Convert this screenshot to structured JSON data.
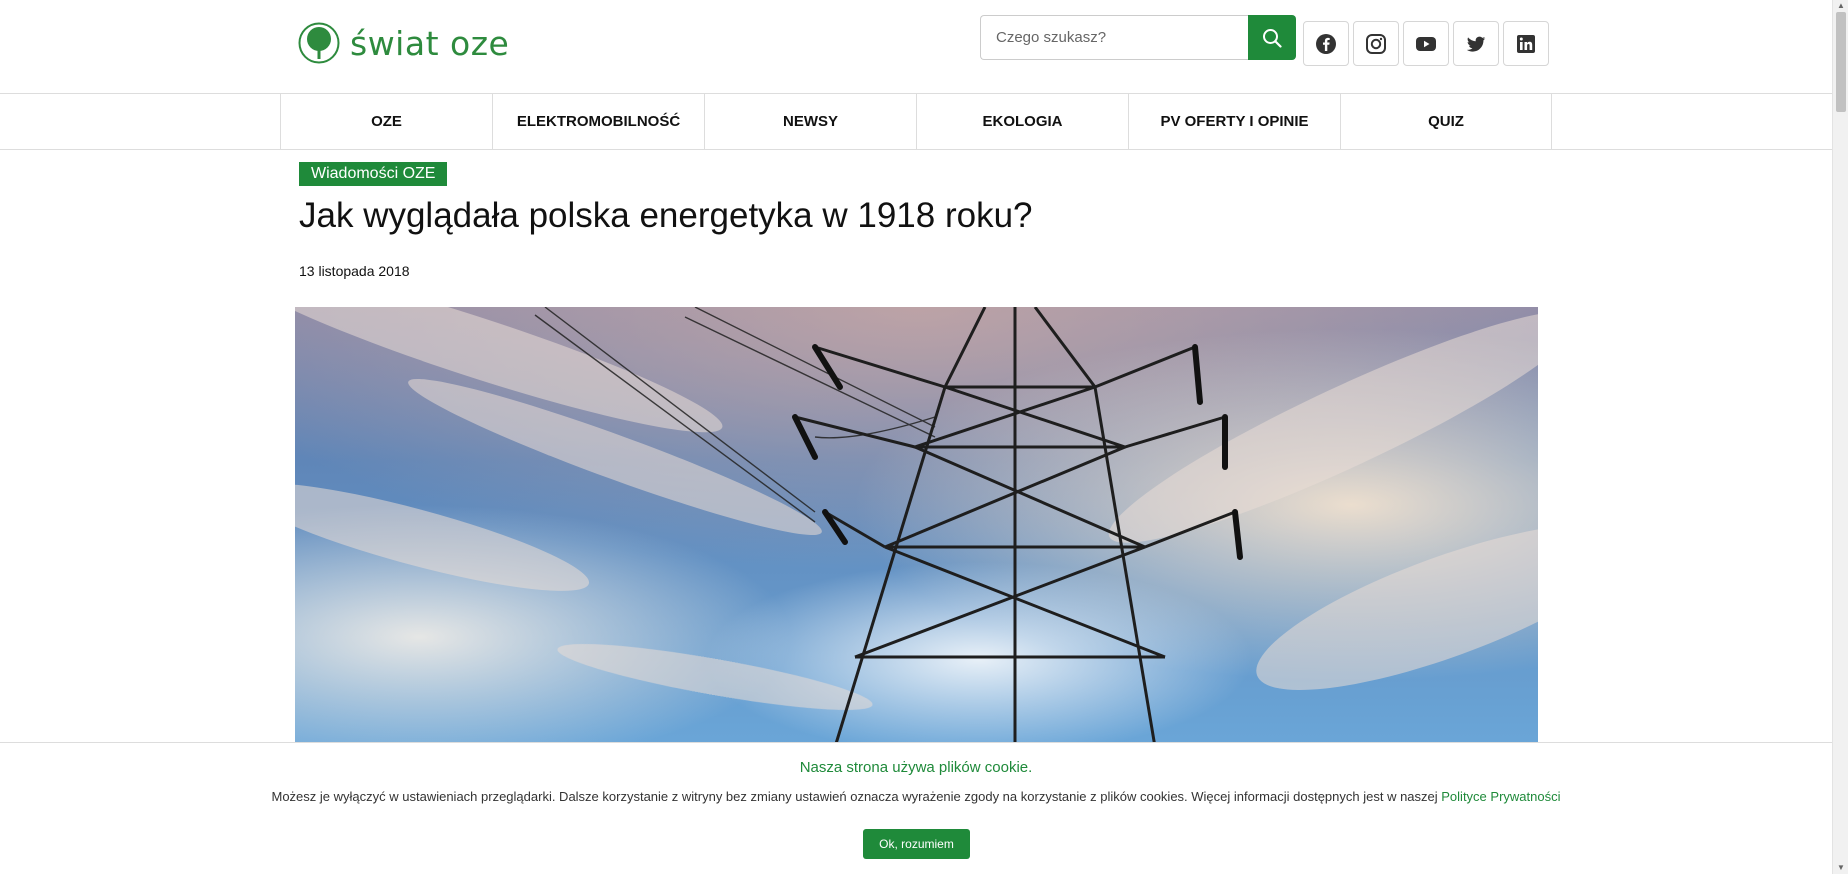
{
  "header": {
    "logo_text": "świat oze",
    "search": {
      "placeholder": "Czego szukasz?"
    },
    "socials": [
      "facebook-icon",
      "instagram-icon",
      "youtube-icon",
      "twitter-icon",
      "linkedin-icon"
    ]
  },
  "nav": {
    "items": [
      {
        "label": "OZE"
      },
      {
        "label": "ELEKTROMOBILNOŚĆ"
      },
      {
        "label": "NEWSY"
      },
      {
        "label": "EKOLOGIA"
      },
      {
        "label": "PV OFERTY I OPINIE"
      },
      {
        "label": "QUIZ"
      }
    ]
  },
  "article": {
    "category": "Wiadomości OZE",
    "title": "Jak wyglądała polska energetyka w 1918 roku?",
    "date": "13 listopada 2018"
  },
  "cookie": {
    "title": "Nasza strona używa plików cookie.",
    "text": "Możesz je wyłączyć w ustawieniach przeglądarki. Dalsze korzystanie z witryny bez zmiany ustawień oznacza wyrażenie zgody na korzystanie z plików cookies. Więcej informacji dostępnych jest w naszej ",
    "link": "Polityce Prywatności",
    "button": "Ok, rozumiem"
  },
  "colors": {
    "brand_green": "#1f8a3a",
    "logo_green": "#2e8b3e"
  }
}
